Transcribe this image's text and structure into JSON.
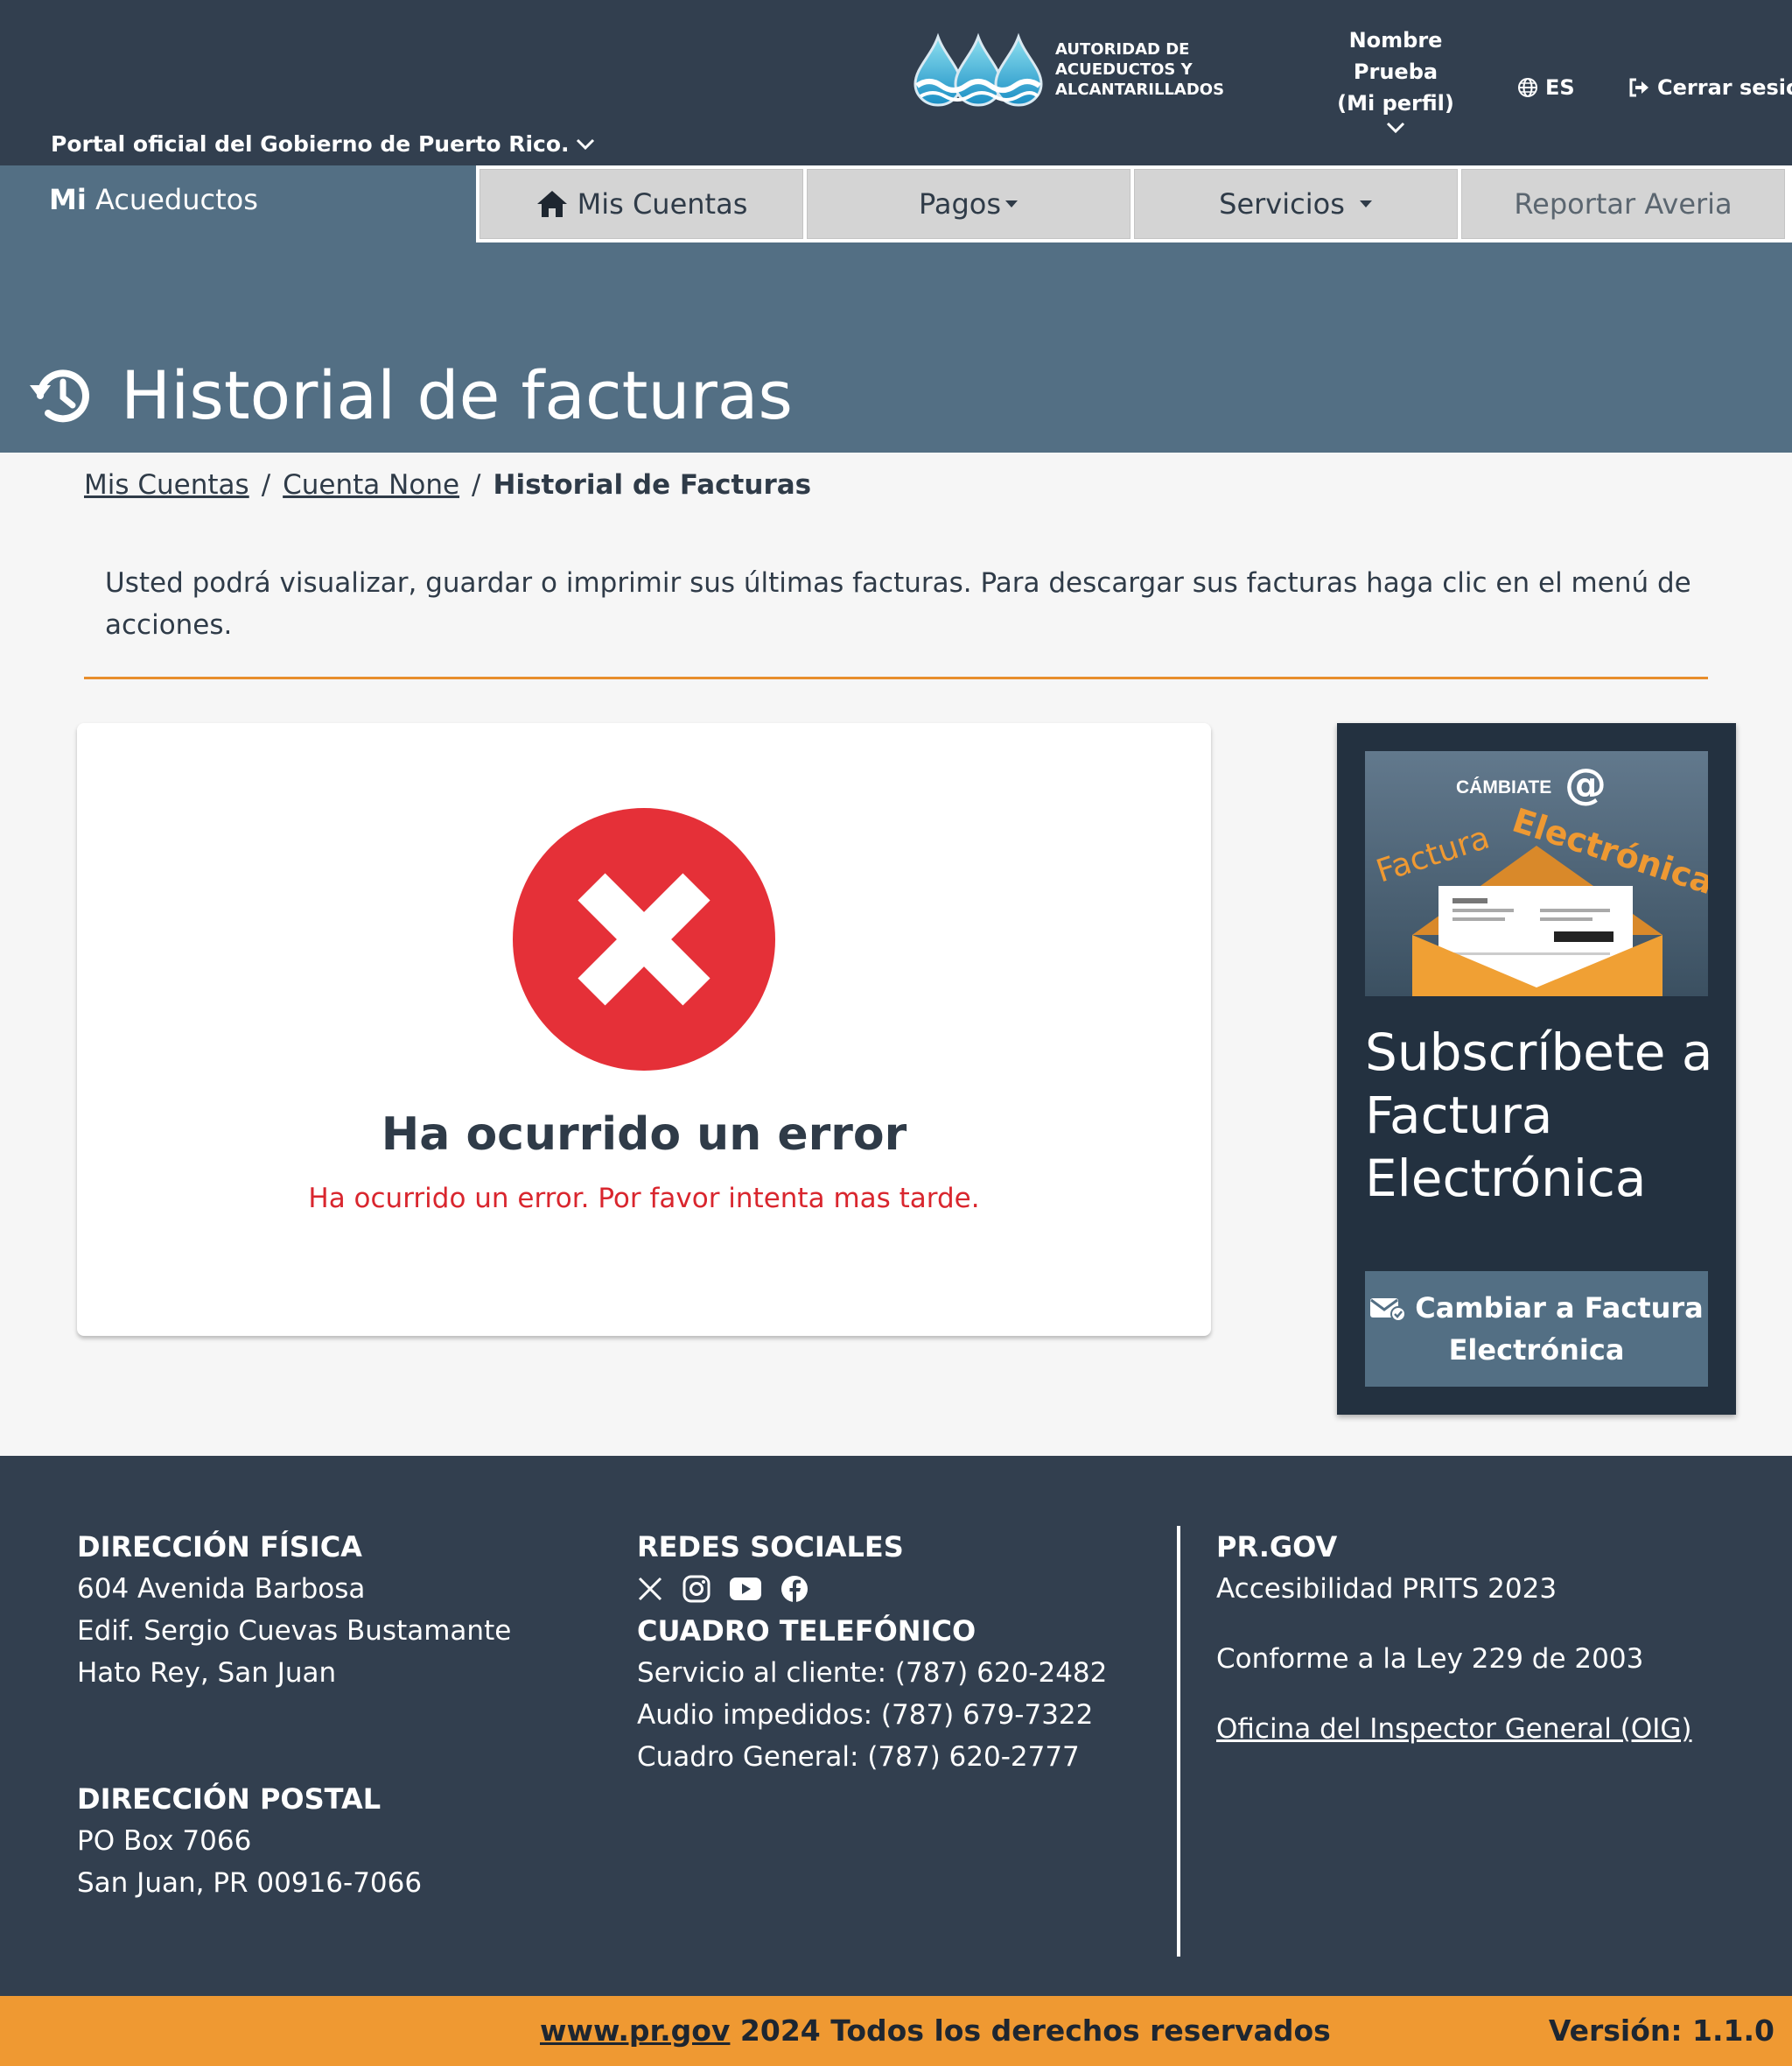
{
  "header": {
    "gov_link": "Portal oficial del Gobierno de Puerto Rico.",
    "logo_text": "AUTORIDAD DE ACUEDUCTOS Y ALCANTARILLADOS",
    "profile_line1": "Nombre",
    "profile_line2": "Prueba",
    "profile_line3": "(Mi perfil)",
    "language": "ES",
    "logout": "Cerrar sesión"
  },
  "nav": {
    "brand_bold": "Mi",
    "brand_rest": "Acueductos",
    "items": [
      {
        "label": "Mis Cuentas",
        "icon": "home-icon"
      },
      {
        "label": "Pagos",
        "icon": "caret-down-icon"
      },
      {
        "label": "Servicios",
        "icon": "caret-down-icon"
      },
      {
        "label": "Reportar Averia"
      }
    ]
  },
  "page": {
    "title": "Historial de facturas",
    "title_icon": "history-icon"
  },
  "breadcrumb": {
    "items": [
      "Mis Cuentas",
      "Cuenta None"
    ],
    "current": "Historial de Facturas",
    "separator": "/"
  },
  "intro": "Usted podrá visualizar, guardar o imprimir sus últimas facturas. Para descargar sus facturas haga clic en el menú de acciones.",
  "error": {
    "title": "Ha ocurrido un error",
    "message": "Ha ocurrido un error. Por favor intenta mas tarde."
  },
  "promo": {
    "banner_small": "CÁMBIATE",
    "banner_word1": "Factura",
    "banner_word2": "Electrónica",
    "title": "Subscríbete a Factura Electrónica",
    "button": "Cambiar a Factura Electrónica"
  },
  "footer": {
    "physical_title": "DIRECCIÓN FÍSICA",
    "physical_lines": [
      "604 Avenida Barbosa",
      "Edif. Sergio Cuevas Bustamante",
      "Hato Rey, San Juan"
    ],
    "postal_title": "DIRECCIÓN POSTAL",
    "postal_lines": [
      "PO Box 7066",
      "San Juan, PR 00916-7066"
    ],
    "social_title": "REDES SOCIALES",
    "phone_title": "CUADRO TELEFÓNICO",
    "phones": [
      "Servicio al cliente: (787) 620-2482",
      "Audio impedidos: (787) 679-7322",
      "Cuadro General: (787) 620-2777"
    ],
    "prgov_title": "PR.GOV",
    "accessibility": "Accesibilidad PRITS 2023",
    "law": "Conforme a la Ley 229 de 2003",
    "oig": "Oficina del Inspector General (OIG)",
    "site_link": "www.pr.gov",
    "rights": " 2024 Todos los derechos reservados",
    "version": "Versión: 1.1.0"
  },
  "colors": {
    "topbar": "#323f4f",
    "hero": "#536f84",
    "accent": "#ef9932",
    "error": "#e53038"
  }
}
